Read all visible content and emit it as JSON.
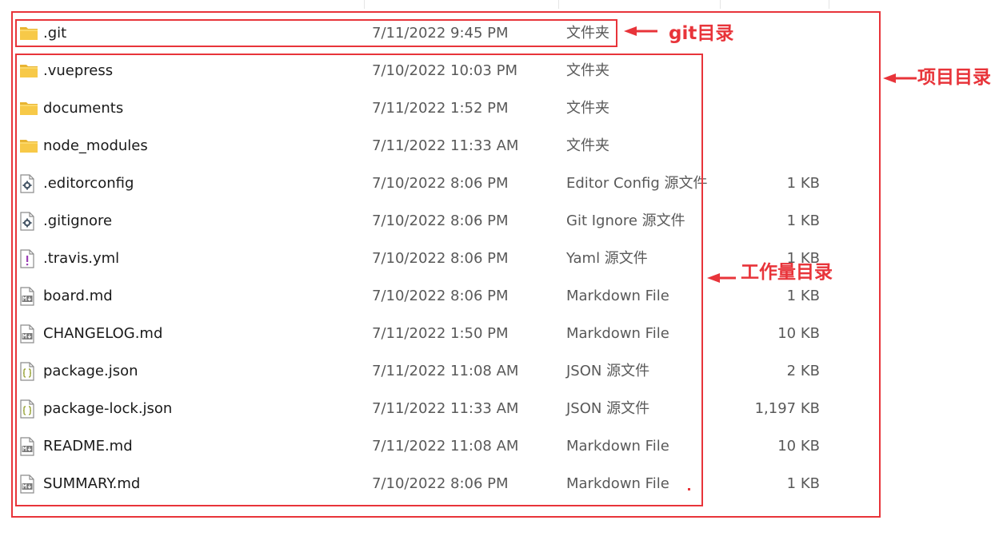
{
  "files": [
    {
      "name": ".git",
      "date": "7/11/2022 9:45 PM",
      "type": "文件夹",
      "size": "",
      "icon": "folder-icon"
    },
    {
      "name": ".vuepress",
      "date": "7/10/2022 10:03 PM",
      "type": "文件夹",
      "size": "",
      "icon": "folder-icon"
    },
    {
      "name": "documents",
      "date": "7/11/2022 1:52 PM",
      "type": "文件夹",
      "size": "",
      "icon": "folder-icon"
    },
    {
      "name": "node_modules",
      "date": "7/11/2022 11:33 AM",
      "type": "文件夹",
      "size": "",
      "icon": "folder-icon"
    },
    {
      "name": ".editorconfig",
      "date": "7/10/2022 8:06 PM",
      "type": "Editor Config 源文件",
      "size": "1 KB",
      "icon": "config-file-icon"
    },
    {
      "name": ".gitignore",
      "date": "7/10/2022 8:06 PM",
      "type": "Git Ignore 源文件",
      "size": "1 KB",
      "icon": "config-file-icon"
    },
    {
      "name": ".travis.yml",
      "date": "7/10/2022 8:06 PM",
      "type": "Yaml 源文件",
      "size": "1 KB",
      "icon": "yaml-file-icon"
    },
    {
      "name": "board.md",
      "date": "7/10/2022 8:06 PM",
      "type": "Markdown File",
      "size": "1 KB",
      "icon": "markdown-file-icon"
    },
    {
      "name": "CHANGELOG.md",
      "date": "7/11/2022 1:50 PM",
      "type": "Markdown File",
      "size": "10 KB",
      "icon": "markdown-file-icon"
    },
    {
      "name": "package.json",
      "date": "7/11/2022 11:08 AM",
      "type": "JSON 源文件",
      "size": "2 KB",
      "icon": "json-file-icon"
    },
    {
      "name": "package-lock.json",
      "date": "7/11/2022 11:33 AM",
      "type": "JSON 源文件",
      "size": "1,197 KB",
      "icon": "json-file-icon"
    },
    {
      "name": "README.md",
      "date": "7/11/2022 11:08 AM",
      "type": "Markdown File",
      "size": "10 KB",
      "icon": "markdown-file-icon"
    },
    {
      "name": "SUMMARY.md",
      "date": "7/10/2022 8:06 PM",
      "type": "Markdown File",
      "size": "1 KB",
      "icon": "markdown-file-icon"
    }
  ],
  "annotations": {
    "git_dir": "git目录",
    "project_dir": "项目目录",
    "workspace_dir": "工作量目录"
  },
  "colors": {
    "annotation_red": "#e8343a",
    "folder_yellow": "#f7c948",
    "text_primary": "#1a1a1a",
    "text_secondary": "#595959"
  }
}
